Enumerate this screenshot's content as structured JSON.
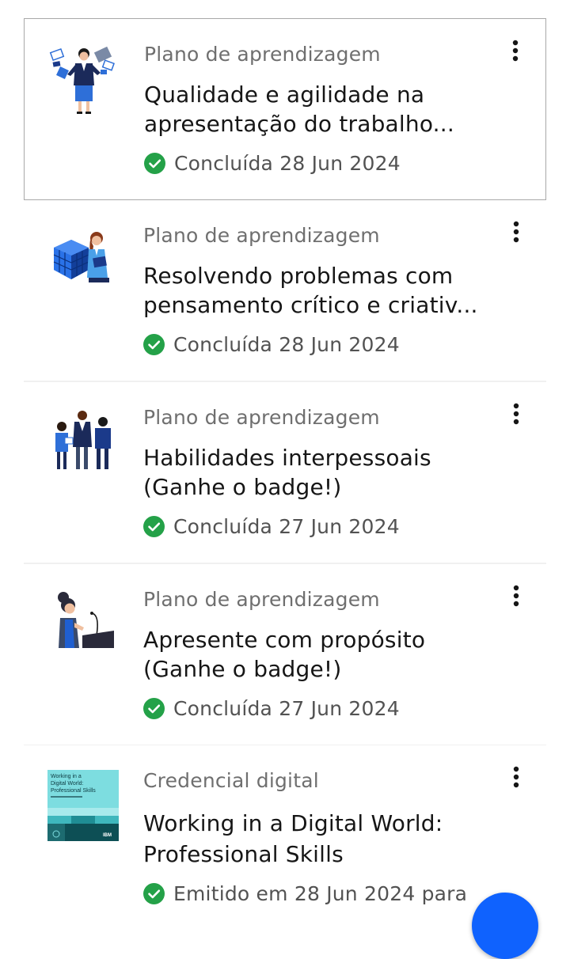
{
  "accent_colors": {
    "success": "#24a148",
    "primary": "#0f62fe",
    "text_secondary": "#6f6f6f"
  },
  "items": [
    {
      "category": "Plano de aprendizagem",
      "title_lines": [
        "Qualidade e agilidade na",
        "apresentação do trabalho..."
      ],
      "status": "Concluída 28 Jun 2024",
      "thumbnail": "woman-with-devices-illustration",
      "selected": true
    },
    {
      "category": "Plano de aprendizagem",
      "title_lines": [
        "Resolvendo problemas com",
        "pensamento crítico e criativ..."
      ],
      "status": "Concluída 28 Jun 2024",
      "thumbnail": "woman-with-cube-illustration",
      "selected": false
    },
    {
      "category": "Plano de aprendizagem",
      "title_lines": [
        "Habilidades interpessoais",
        "(Ganhe o badge!)"
      ],
      "status": "Concluída 27 Jun 2024",
      "thumbnail": "group-of-people-illustration",
      "selected": false
    },
    {
      "category": "Plano de aprendizagem",
      "title_lines": [
        "Apresente com propósito",
        "(Ganhe o badge!)"
      ],
      "status": "Concluída 27 Jun 2024",
      "thumbnail": "woman-at-podium-illustration",
      "selected": false
    },
    {
      "category": "Credencial digital",
      "title_lines": [
        "Working in a Digital World:",
        "Professional Skills"
      ],
      "status": "Emitido em 28 Jun 2024 para",
      "thumbnail": "digital-badge-image",
      "badge_text": {
        "line1": "Working in a",
        "line2": "Digital World:",
        "line3": "Professional Skills",
        "brand": "IBM"
      },
      "selected": false
    }
  ]
}
